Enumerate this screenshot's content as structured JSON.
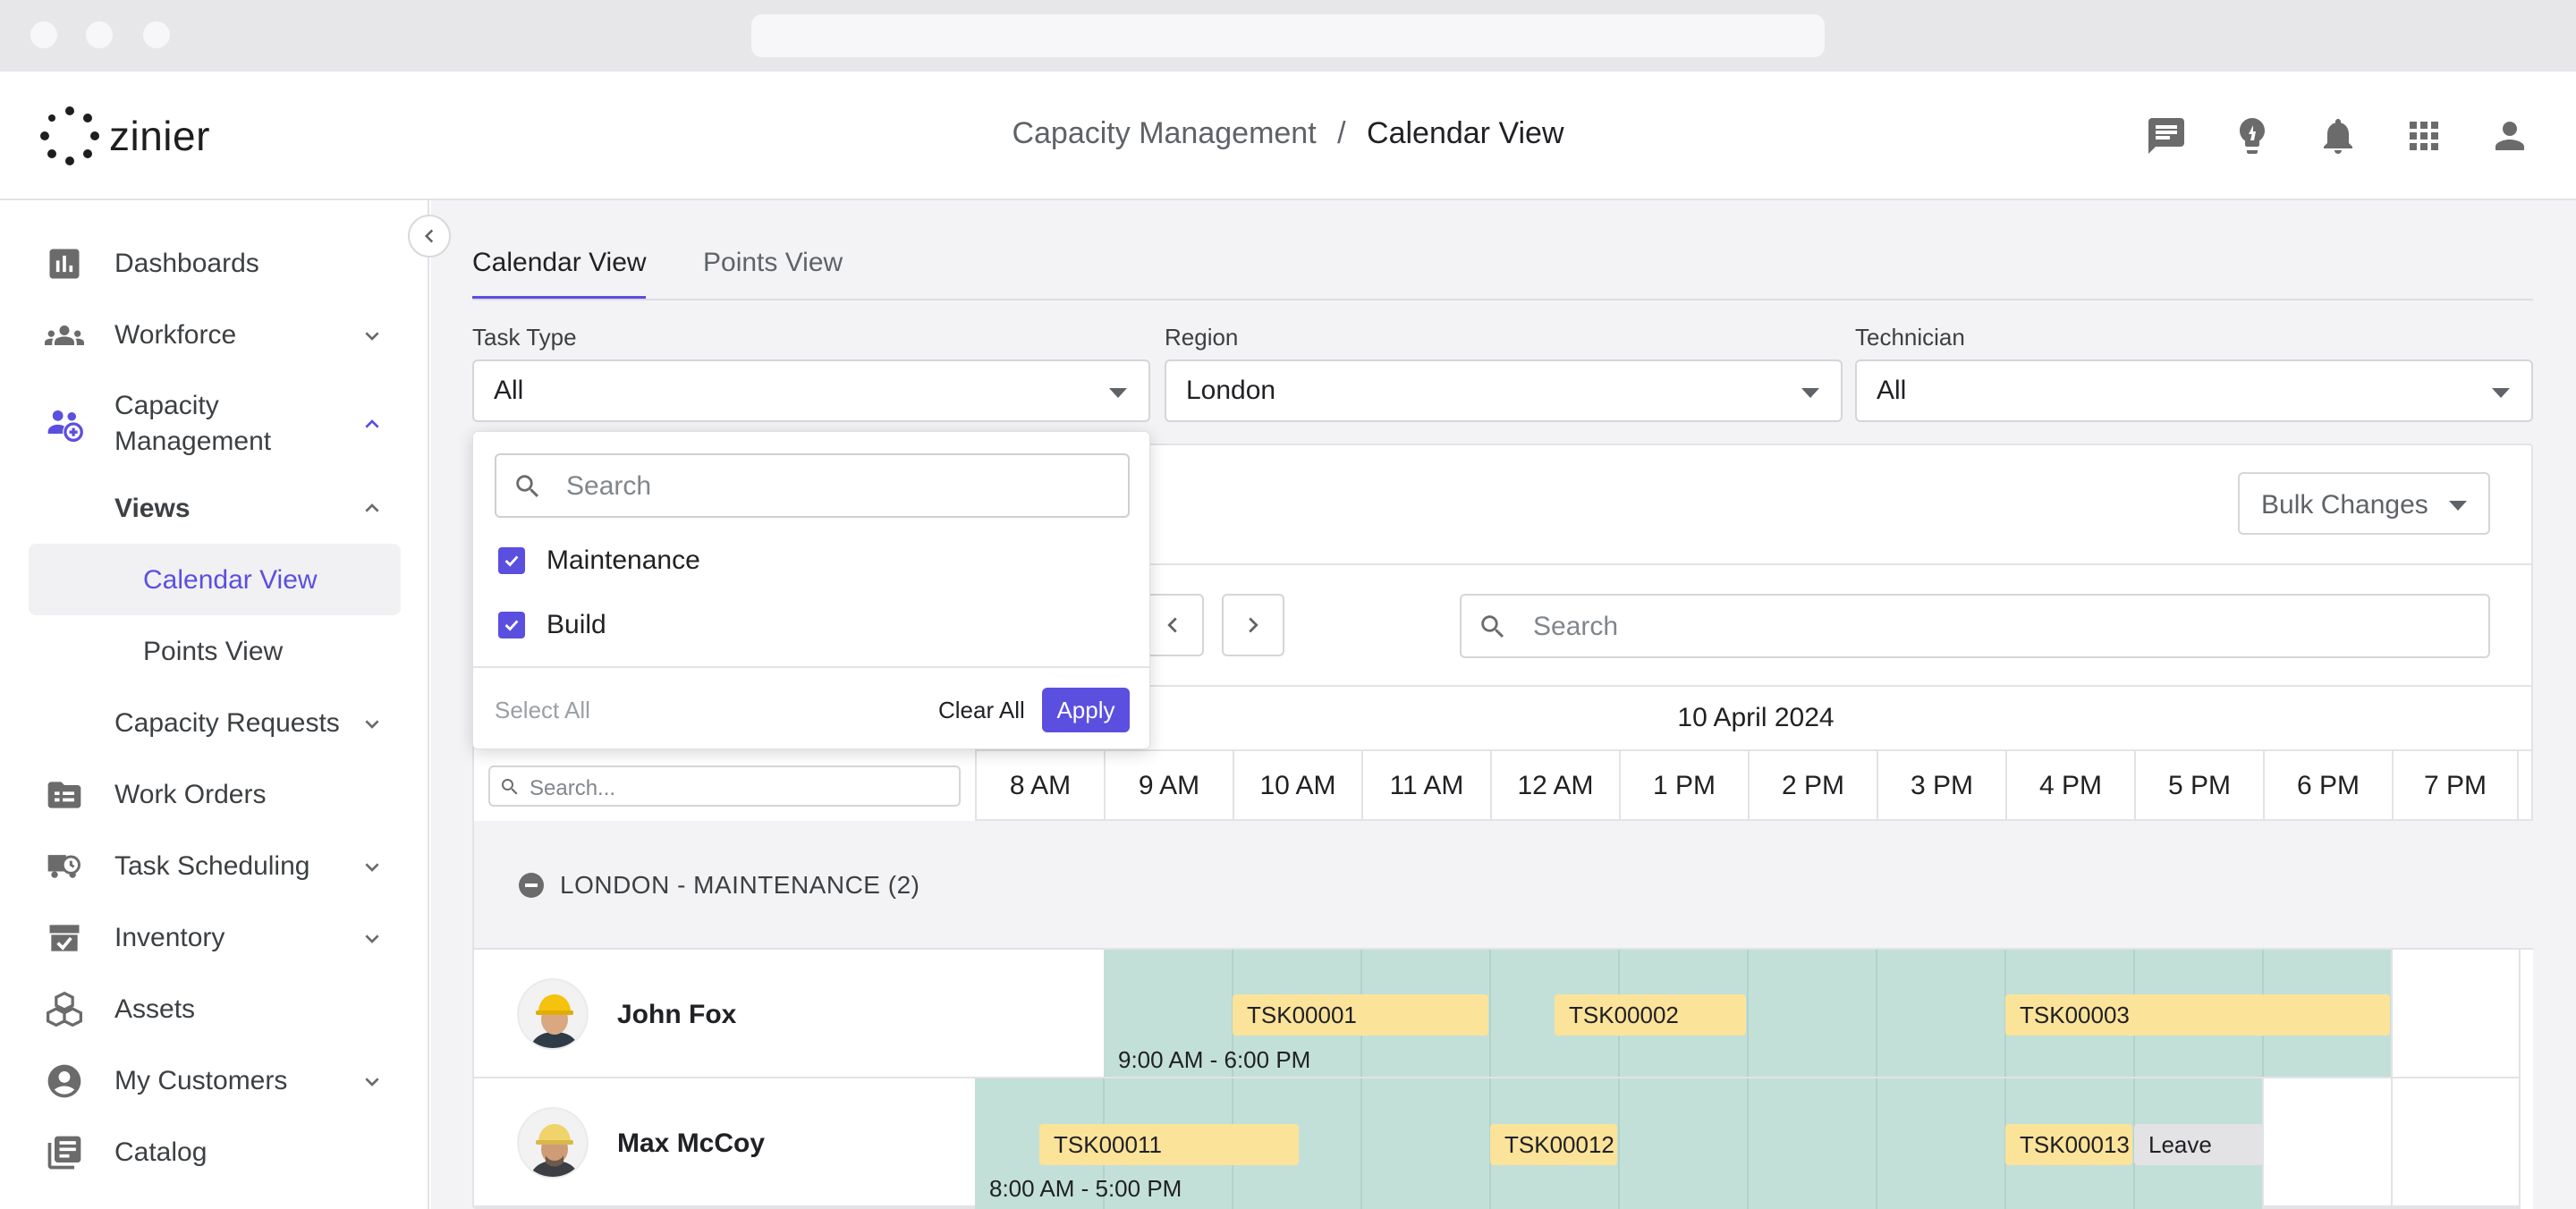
{
  "app": {
    "logo_text": "zinier",
    "breadcrumb": {
      "parent": "Capacity Management",
      "separator": "/",
      "current": "Calendar View"
    }
  },
  "header_icons": [
    "chat-icon",
    "lightbulb-icon",
    "bell-icon",
    "apps-grid-icon",
    "user-icon"
  ],
  "sidebar": {
    "items": [
      {
        "label": "Dashboards",
        "icon": "bar-chart-icon"
      },
      {
        "label": "Workforce",
        "icon": "people-icon"
      },
      {
        "label": "Capacity\nManagement",
        "icon": "capacity-icon"
      },
      {
        "label": "Views"
      },
      {
        "label": "Calendar View"
      },
      {
        "label": "Points View"
      },
      {
        "label": "Capacity Requests"
      },
      {
        "label": "Work Orders",
        "icon": "folder-icon"
      },
      {
        "label": "Task Scheduling",
        "icon": "truck-clock-icon"
      },
      {
        "label": "Inventory",
        "icon": "box-check-icon"
      },
      {
        "label": "Assets",
        "icon": "cubes-icon"
      },
      {
        "label": "My Customers",
        "icon": "account-circle-icon"
      },
      {
        "label": "Catalog",
        "icon": "book-icon"
      }
    ]
  },
  "tabs": [
    {
      "label": "Calendar View",
      "active": true
    },
    {
      "label": "Points View",
      "active": false
    }
  ],
  "filters": {
    "task_type": {
      "label": "Task Type",
      "value": "All"
    },
    "region": {
      "label": "Region",
      "value": "London"
    },
    "technician": {
      "label": "Technician",
      "value": "All"
    }
  },
  "dropdown": {
    "search_placeholder": "Search",
    "options": [
      {
        "label": "Maintenance",
        "checked": true
      },
      {
        "label": "Build",
        "checked": true
      }
    ],
    "select_all": "Select All",
    "clear_all": "Clear All",
    "apply": "Apply"
  },
  "toolbar": {
    "bulk_changes": "Bulk Changes",
    "search_placeholder": "Search"
  },
  "calendar": {
    "date": "10 April 2024",
    "grid_search_placeholder": "Search...",
    "hours": [
      "8 AM",
      "9 AM",
      "10 AM",
      "11 AM",
      "12 AM",
      "1 PM",
      "2 PM",
      "3 PM",
      "4 PM",
      "5 PM",
      "6 PM",
      "7 PM"
    ],
    "group": "LONDON - MAINTENANCE (2)",
    "technicians": [
      {
        "name": "John Fox",
        "shift": "9:00 AM - 6:00 PM",
        "tasks": [
          "TSK00001",
          "TSK00002",
          "TSK00003"
        ]
      },
      {
        "name": "Max McCoy",
        "shift": "8:00 AM - 5:00 PM",
        "tasks": [
          "TSK00011",
          "TSK00012",
          "TSK00013"
        ],
        "leave": "Leave"
      }
    ]
  },
  "colors": {
    "accent": "#5b4fe0",
    "task": "#fce39a",
    "shift": "#c3e0d8",
    "leave": "#e3e3e6"
  }
}
